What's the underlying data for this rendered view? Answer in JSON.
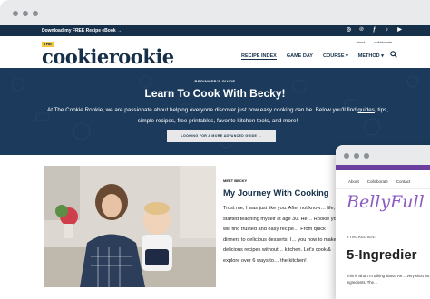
{
  "topbar": {
    "promo": "Download my FREE Recipe eBook →"
  },
  "header": {
    "logo_the": "THE",
    "logo_name": "cookierookie",
    "toplinks": [
      "about",
      "collaborate"
    ],
    "nav": [
      "RECIPE INDEX",
      "GAME DAY",
      "COURSE ▾",
      "METHOD ▾"
    ]
  },
  "hero": {
    "eyebrow": "BEGINNER'S GUIDE",
    "title": "Learn To Cook With Becky!",
    "text_before_link": "At The Cookie Rookie, we are passionate about helping everyone discover just how easy cooking can be. Below you'll find ",
    "text_link": "guides",
    "text_after_link": ", tips, simple recipes, free printables, favorite kitchen tools, and more!",
    "button": "LOOKING FOR A MORE ADVANCED GUIDE →"
  },
  "about": {
    "eyebrow": "MEET BECKY",
    "title": "My Journey With Cooking",
    "bio": "Trust me, I was just like you. After not know… life, I started teaching myself at age 30. He… Rookie you will find trusted and easy recipe… From quick dinners to delicious desserts, I… you how to make delicious recipes without… kitchen. Let's cook & explore over 6 ways to… the kitchen!"
  },
  "second_window": {
    "links": [
      "About",
      "Collaborate",
      "Contact"
    ],
    "brand": "BellyFull",
    "label": "5 INGREDIENT",
    "title": "5-Ingredier",
    "text": "This is what I'm talking about! Re… very short list of ingredients. The…"
  },
  "colors": {
    "navy": "#16304a",
    "hero_bg": "#1c3b5c",
    "yellow": "#f2c744",
    "purple": "#6b3fa0"
  }
}
